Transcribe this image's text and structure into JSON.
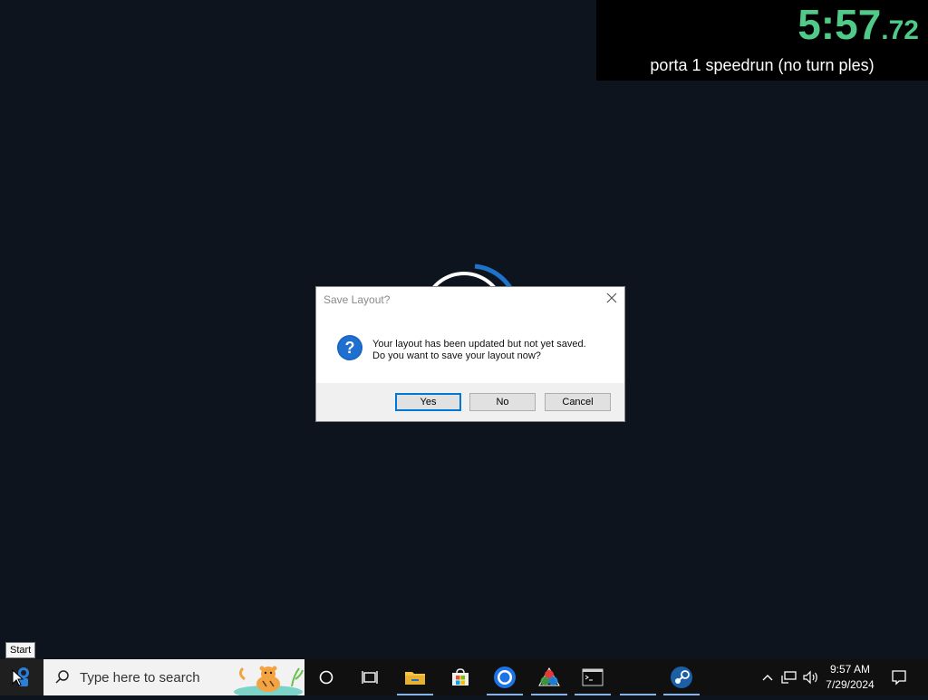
{
  "timer": {
    "time_main": "5:57",
    "time_ms": ".72",
    "run_title": "porta 1 speedrun (no turn ples)"
  },
  "dialog": {
    "title": "Save Layout?",
    "message_line1": "Your layout has been updated but not yet saved.",
    "message_line2": "Do you want to save your layout now?",
    "buttons": {
      "yes": "Yes",
      "no": "No",
      "cancel": "Cancel"
    },
    "icon": "question-icon",
    "default_button_color": "#0078d7"
  },
  "tooltip": {
    "text": "Start"
  },
  "taskbar": {
    "search_placeholder": "Type here to search",
    "apps": [
      "cortana-icon",
      "task-view-icon",
      "file-explorer-icon",
      "store-icon",
      "chrome-icon",
      "color-app-icon",
      "terminal-icon",
      "steam-icon"
    ],
    "tray_icons": [
      "chevron-up-icon",
      "network-icon",
      "volume-icon",
      "notification-icon"
    ],
    "clock_time": "9:57 AM",
    "clock_date": "7/29/2024"
  },
  "colors": {
    "desktop_bg": "#0d141d",
    "timer_green": "#4fca88",
    "taskbar_bg": "#101010"
  }
}
